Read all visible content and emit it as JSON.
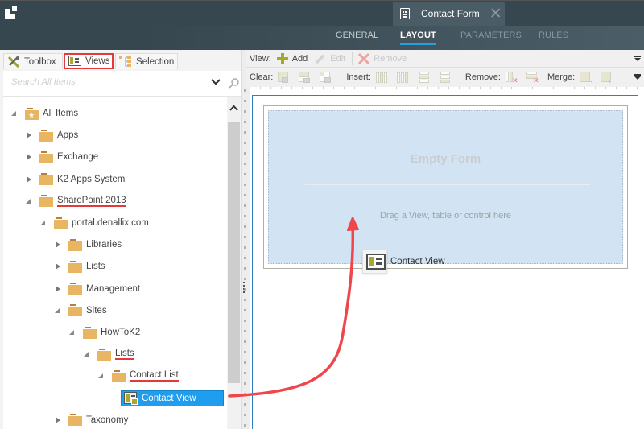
{
  "header": {
    "document_tab": {
      "title": "Contact Form",
      "icon": "form-document-icon",
      "close_icon": "close-icon"
    },
    "subtabs": [
      {
        "label": "GENERAL",
        "state": "normal"
      },
      {
        "label": "LAYOUT",
        "state": "active"
      },
      {
        "label": "PARAMETERS",
        "state": "disabled"
      },
      {
        "label": "RULES",
        "state": "disabled"
      }
    ],
    "accent_color": "#25a0e0"
  },
  "left_panel": {
    "tabs": [
      {
        "label": "Toolbox",
        "icon": "wrench-screwdriver-icon"
      },
      {
        "label": "Views",
        "icon": "view-icon",
        "highlighted": true
      },
      {
        "label": "Selection",
        "icon": "hierarchy-icon"
      }
    ],
    "search": {
      "placeholder": "Search All Items",
      "value": ""
    },
    "tree": [
      {
        "label": "All Items",
        "level": 0,
        "state": "expanded",
        "icon": "star-folder-icon"
      },
      {
        "label": "Apps",
        "level": 1,
        "state": "collapsed",
        "icon": "folder-icon"
      },
      {
        "label": "Exchange",
        "level": 1,
        "state": "collapsed",
        "icon": "folder-icon"
      },
      {
        "label": "K2 Apps System",
        "level": 1,
        "state": "collapsed",
        "icon": "folder-icon"
      },
      {
        "label": "SharePoint 2013",
        "level": 1,
        "state": "expanded",
        "icon": "folder-icon",
        "underlined": true
      },
      {
        "label": "portal.denallix.com",
        "level": 2,
        "state": "expanded",
        "icon": "folder-icon"
      },
      {
        "label": "Libraries",
        "level": 3,
        "state": "collapsed",
        "icon": "folder-icon"
      },
      {
        "label": "Lists",
        "level": 3,
        "state": "collapsed",
        "icon": "folder-icon"
      },
      {
        "label": "Management",
        "level": 3,
        "state": "collapsed",
        "icon": "folder-icon"
      },
      {
        "label": "Sites",
        "level": 3,
        "state": "expanded",
        "icon": "folder-icon"
      },
      {
        "label": "HowToK2",
        "level": 4,
        "state": "expanded",
        "icon": "folder-icon"
      },
      {
        "label": "Lists",
        "level": 5,
        "state": "expanded",
        "icon": "folder-icon",
        "underlined": true
      },
      {
        "label": "Contact List",
        "level": 6,
        "state": "expanded",
        "icon": "folder-icon",
        "underlined": true
      },
      {
        "label": "Contact View",
        "level": 7,
        "state": "leaf",
        "icon": "view-icon",
        "selected": true
      },
      {
        "label": "Taxonomy",
        "level": 3,
        "state": "collapsed",
        "icon": "folder-icon"
      }
    ]
  },
  "toolbar": {
    "row1": {
      "label": "View:",
      "buttons": [
        {
          "label": "Add",
          "icon": "plus-icon",
          "enabled": true
        },
        {
          "label": "Edit",
          "icon": "pencil-icon",
          "enabled": false
        },
        {
          "label": "Remove",
          "icon": "x-icon",
          "enabled": false
        }
      ]
    },
    "row2": {
      "groups": [
        {
          "label": "Clear:",
          "icons": [
            "clear-cell-icon",
            "clear-row-icon",
            "clear-table-icon"
          ]
        },
        {
          "label": "Insert:",
          "icons": [
            "insert-column-left-icon",
            "insert-column-right-icon",
            "insert-row-above-icon",
            "insert-row-below-icon"
          ]
        },
        {
          "label": "Remove:",
          "icons": [
            "remove-column-icon",
            "remove-row-icon"
          ]
        },
        {
          "label": "Merge:",
          "icons": [
            "merge-right-icon",
            "merge-down-icon"
          ]
        }
      ]
    }
  },
  "canvas": {
    "empty_title": "Empty Form",
    "empty_hint": "Drag a View, table or control here",
    "drag_ghost_label": "Contact View",
    "annotation_color": "#f0454b"
  }
}
